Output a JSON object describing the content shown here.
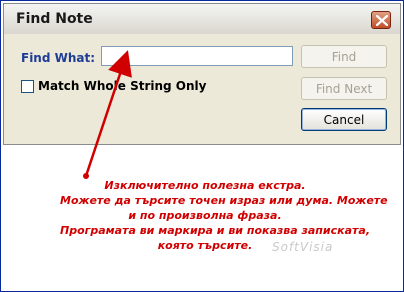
{
  "window": {
    "title": "Find Note"
  },
  "form": {
    "find_label": "Find What:",
    "find_value": "",
    "match_label": "Match Whole String Only",
    "match_checked": false
  },
  "buttons": {
    "find": "Find",
    "find_next": "Find Next",
    "cancel": "Cancel"
  },
  "annotation": {
    "lines": [
      "Изключително полезна екстра.",
      "Можете да търсите точен израз или дума. Можете",
      "и по произволна фраза.",
      "Програмата ви маркира и ви показва записката,",
      "която търсите."
    ],
    "color": "#d10000"
  },
  "watermark": "SoftVisia",
  "icons": {
    "close": "close-icon",
    "checkbox": "checkbox-icon",
    "arrow": "arrow-icon"
  }
}
